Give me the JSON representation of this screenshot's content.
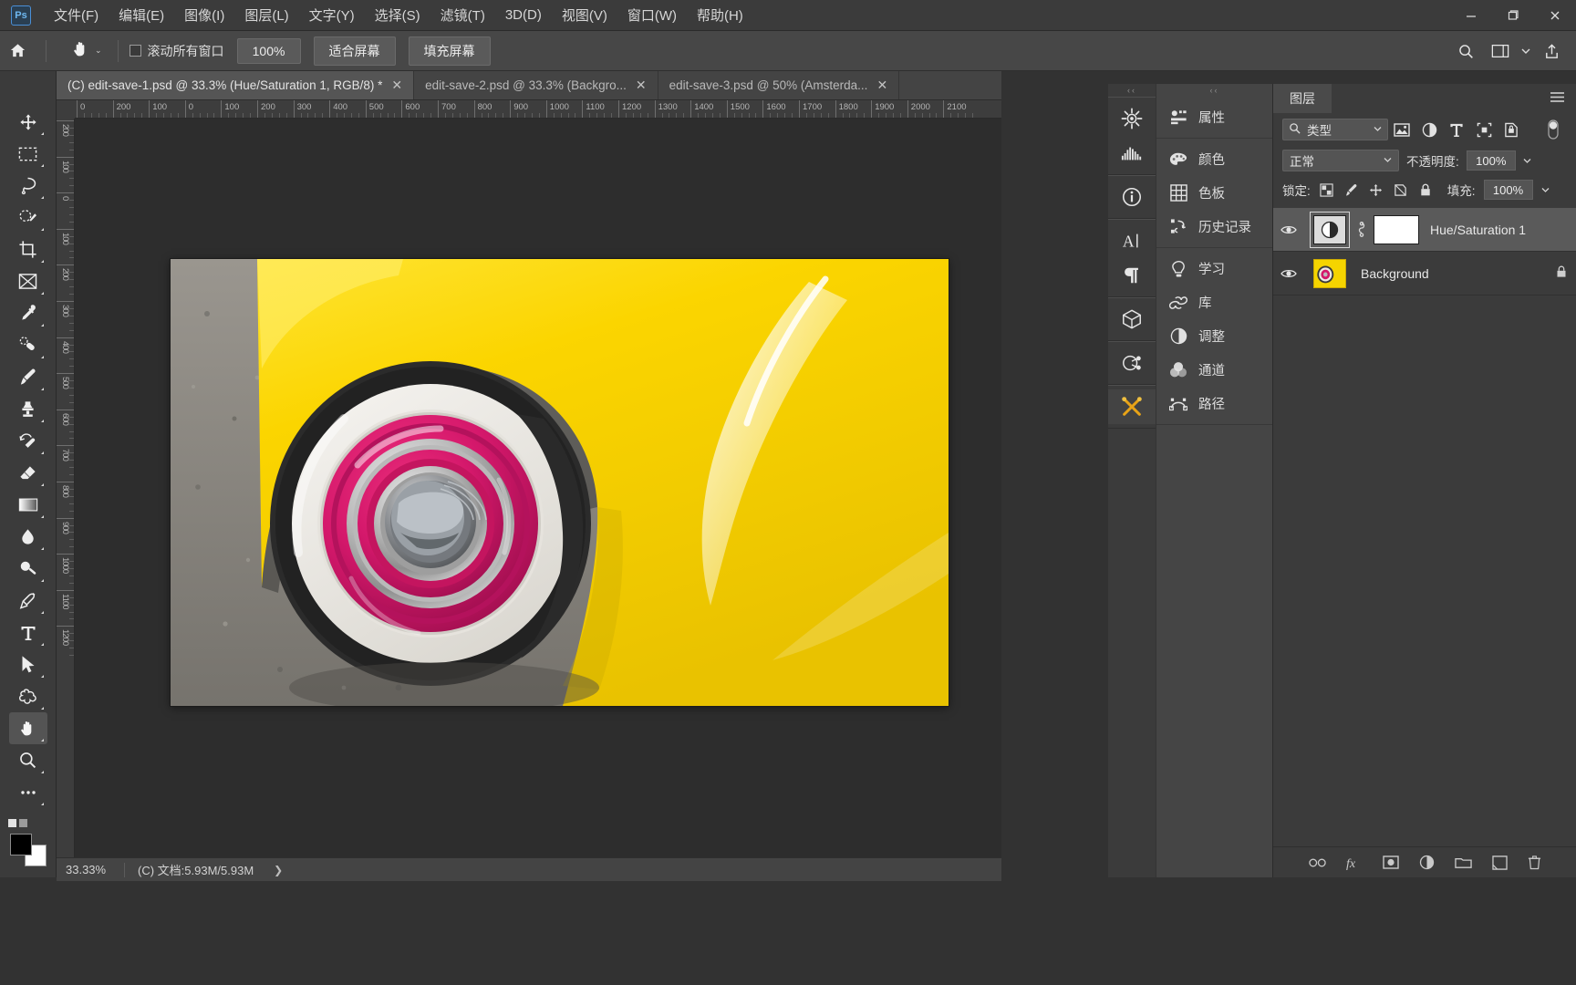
{
  "app": {
    "logo_text": "Ps",
    "menus": [
      {
        "label": "文件(F)"
      },
      {
        "label": "编辑(E)"
      },
      {
        "label": "图像(I)"
      },
      {
        "label": "图层(L)"
      },
      {
        "label": "文字(Y)"
      },
      {
        "label": "选择(S)"
      },
      {
        "label": "滤镜(T)"
      },
      {
        "label": "3D(D)"
      },
      {
        "label": "视图(V)"
      },
      {
        "label": "窗口(W)"
      },
      {
        "label": "帮助(H)"
      }
    ],
    "window_buttons": {
      "minimize": "—",
      "maximize": "❐",
      "close": "✕"
    }
  },
  "options_bar": {
    "home_icon": "home-icon",
    "active_tool_icon": "hand-tool-icon",
    "tool_preset_caret": "⌄",
    "scroll_all_windows_label": "滚动所有窗口",
    "scroll_all_windows_checked": false,
    "zoom_100_label": "100%",
    "fit_screen_label": "适合屏幕",
    "fill_screen_label": "填充屏幕",
    "right_icons": [
      "search-icon",
      "workspace-icon",
      "chevron-down-icon",
      "share-icon"
    ]
  },
  "tabs": [
    {
      "title": "(C) edit-save-1.psd @ 33.3% (Hue/Saturation 1, RGB/8) *",
      "active": true,
      "close": "✕"
    },
    {
      "title": "edit-save-2.psd @ 33.3% (Backgro...",
      "active": false,
      "close": "✕"
    },
    {
      "title": "edit-save-3.psd @ 50% (Amsterda...",
      "active": false,
      "close": "✕"
    }
  ],
  "toolbar": {
    "tools": [
      {
        "name": "move-tool",
        "active": false
      },
      {
        "name": "rectangular-marquee-tool",
        "active": false
      },
      {
        "name": "lasso-tool",
        "active": false
      },
      {
        "name": "quick-selection-tool",
        "active": false
      },
      {
        "name": "crop-tool",
        "active": false
      },
      {
        "name": "frame-tool",
        "active": false
      },
      {
        "name": "eyedropper-tool",
        "active": false
      },
      {
        "name": "spot-healing-brush-tool",
        "active": false
      },
      {
        "name": "brush-tool",
        "active": false
      },
      {
        "name": "clone-stamp-tool",
        "active": false
      },
      {
        "name": "history-brush-tool",
        "active": false
      },
      {
        "name": "eraser-tool",
        "active": false
      },
      {
        "name": "gradient-tool",
        "active": false
      },
      {
        "name": "blur-tool",
        "active": false
      },
      {
        "name": "dodge-tool",
        "active": false
      },
      {
        "name": "pen-tool",
        "active": false
      },
      {
        "name": "horizontal-type-tool",
        "active": false
      },
      {
        "name": "path-selection-tool",
        "active": false
      },
      {
        "name": "custom-shape-tool",
        "active": false
      },
      {
        "name": "hand-tool",
        "active": true
      },
      {
        "name": "zoom-tool",
        "active": false
      },
      {
        "name": "edit-toolbar-tool",
        "active": false
      }
    ],
    "foreground_color": "#000000",
    "background_color": "#ffffff"
  },
  "rulers": {
    "unit_hint": "px",
    "h_labels": [
      "0",
      "200",
      "100",
      "0",
      "100",
      "200",
      "300",
      "400",
      "500",
      "600",
      "700",
      "800",
      "900",
      "1000",
      "1100",
      "1200",
      "1300",
      "1400",
      "1500",
      "1600",
      "1700",
      "1800",
      "1900",
      "2000",
      "2100"
    ],
    "v_labels": [
      "200",
      "100",
      "0",
      "100",
      "200",
      "300",
      "400",
      "500",
      "600",
      "700",
      "800",
      "900",
      "1000",
      "1100",
      "1200"
    ]
  },
  "status_bar": {
    "zoom": "33.33%",
    "doc_info": "(C) 文档:5.93M/5.93M",
    "arrow": "❯"
  },
  "panel_rail": {
    "groups": [
      [
        "adjustments-icon",
        "histogram-icon"
      ],
      [
        "info-icon"
      ],
      [
        "character-icon",
        "paragraph-icon"
      ],
      [
        "3d-icon"
      ],
      [
        "actions-icon"
      ],
      [
        "brushes-icon"
      ]
    ],
    "accent_color": "#e8a317"
  },
  "panel_list": {
    "groups": [
      [
        {
          "icon": "properties-icon",
          "label": "属性"
        }
      ],
      [
        {
          "icon": "color-icon",
          "label": "颜色"
        },
        {
          "icon": "swatches-icon",
          "label": "色板"
        },
        {
          "icon": "history-icon",
          "label": "历史记录"
        }
      ],
      [
        {
          "icon": "learn-icon",
          "label": "学习"
        },
        {
          "icon": "libraries-icon",
          "label": "库"
        },
        {
          "icon": "adjustments-icon",
          "label": "调整"
        },
        {
          "icon": "channels-icon",
          "label": "通道"
        },
        {
          "icon": "paths-icon",
          "label": "路径"
        }
      ]
    ]
  },
  "layers_panel": {
    "tab_label": "图层",
    "menu_icon": "hamburger-icon",
    "filter": {
      "search_icon": "search-icon",
      "kind_label": "类型",
      "caret": "⌄",
      "filter_icons": [
        "pixel-filter-icon",
        "adjustment-filter-icon",
        "type-filter-icon",
        "shape-filter-icon",
        "smart-object-filter-icon"
      ],
      "toggle_icon": "filter-toggle-icon"
    },
    "blend_mode": "正常",
    "blend_caret": "⌄",
    "opacity_label": "不透明度:",
    "opacity_value": "100%",
    "opacity_caret": "⌄",
    "lock_label": "锁定:",
    "lock_icons": [
      "lock-transparent-icon",
      "lock-image-icon",
      "lock-position-icon",
      "lock-artboard-icon",
      "lock-all-icon"
    ],
    "fill_label": "填充:",
    "fill_value": "100%",
    "fill_caret": "⌄",
    "layers": [
      {
        "name": "Hue/Saturation 1",
        "visible": true,
        "selected": true,
        "thumb_type": "adjustment",
        "has_link": true,
        "has_mask": true,
        "mask_color": "#ffffff",
        "locked": false
      },
      {
        "name": "Background",
        "visible": true,
        "selected": false,
        "thumb_type": "image",
        "has_link": false,
        "has_mask": false,
        "locked": true,
        "lock_badge": "lock-icon"
      }
    ],
    "bottom_icons": [
      "link-layers-icon",
      "layer-style-fx-icon",
      "add-mask-icon",
      "new-adjustment-layer-icon",
      "new-group-icon",
      "new-layer-icon",
      "delete-layer-icon"
    ],
    "bottom_labels": [
      "∞",
      "fx",
      "◻",
      "◕",
      "▭",
      "⧉",
      "🗑"
    ]
  },
  "document_image": {
    "description": "Close-up photograph of a yellow classic car fender with a whitewall tire and a magenta/pink hubcap with chrome center",
    "colors": {
      "body": "#F5D400",
      "body_highlight": "#FFF06A",
      "tire": "#2b2b2b",
      "whitewall": "#e9e7e2",
      "hub_pink": "#D4186B",
      "hub_pink_dark": "#9e0f4f",
      "chrome": "#c9c9c9",
      "asphalt": "#8d8a85"
    }
  }
}
